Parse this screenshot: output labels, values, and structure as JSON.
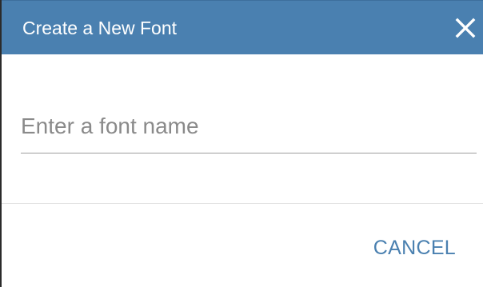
{
  "dialog": {
    "title": "Create a New Font",
    "close_icon": "close-icon",
    "accent_color": "#4a80b0"
  },
  "form": {
    "font_name": {
      "value": "",
      "placeholder": "Enter a font name"
    }
  },
  "actions": {
    "cancel_label": "CANCEL"
  }
}
